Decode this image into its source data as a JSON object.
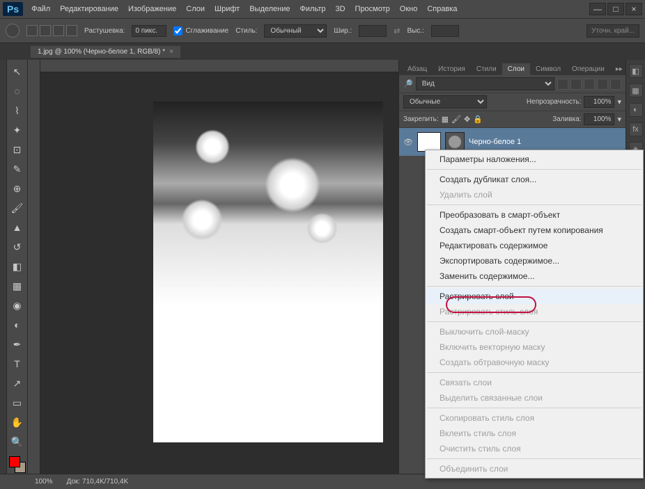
{
  "app": {
    "logo": "Ps"
  },
  "menu": {
    "file": "Файл",
    "edit": "Редактирование",
    "image": "Изображение",
    "layer": "Слои",
    "type": "Шрифт",
    "select": "Выделение",
    "filter": "Фильтр",
    "threeD": "3D",
    "view": "Просмотр",
    "window": "Окно",
    "help": "Справка"
  },
  "options": {
    "feather_label": "Растушевка:",
    "feather_value": "0 пикс.",
    "antialias": "Сглаживание",
    "style_label": "Стиль:",
    "style_value": "Обычный",
    "width_label": "Шир.:",
    "height_label": "Выс.:",
    "refine": "Уточн. край..."
  },
  "tab": {
    "title": "1.jpg @ 100% (Черно-белое 1, RGB/8) *",
    "close": "×"
  },
  "panel_tabs": {
    "paragraph": "Абзац",
    "history": "История",
    "styles": "Стили",
    "layers": "Слои",
    "symbol": "Символ",
    "actions": "Операции"
  },
  "layers": {
    "kind_label": "Вид",
    "mode": "Обычные",
    "opacity_label": "Непрозрачность:",
    "opacity": "100%",
    "lock_label": "Закрепить:",
    "fill_label": "Заливка:",
    "fill": "100%",
    "layer1_name": "Черно-белое 1"
  },
  "ctx": {
    "blending": "Параметры наложения...",
    "duplicate": "Создать дубликат слоя...",
    "delete": "Удалить слой",
    "convert_smart": "Преобразовать в смарт-объект",
    "new_smart_copy": "Создать смарт-объект путем копирования",
    "edit_contents": "Редактировать содержимое",
    "export_contents": "Экспортировать содержимое...",
    "replace_contents": "Заменить содержимое...",
    "rasterize": "Растрировать слой",
    "rasterize_style": "Растрировать стиль слоя",
    "disable_mask": "Выключить слой-маску",
    "enable_vmask": "Включить векторную маску",
    "create_clip": "Создать обтравочную маску",
    "link": "Связать слои",
    "select_linked": "Выделить связанные слои",
    "copy_style": "Скопировать стиль слоя",
    "paste_style": "Вклеить стиль слоя",
    "clear_style": "Очистить стиль слоя",
    "merge": "Объединить слои"
  },
  "status": {
    "zoom": "100%",
    "doc_label": "Док:",
    "doc_size": "710,4K/710,4K"
  }
}
